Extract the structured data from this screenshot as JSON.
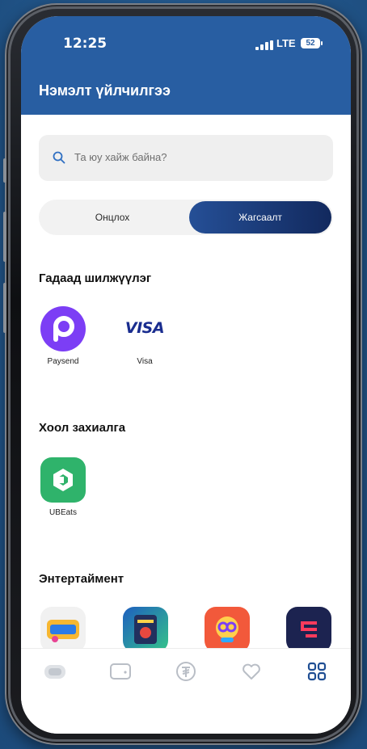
{
  "status_bar": {
    "time": "12:25",
    "network": "LTE",
    "battery": "52"
  },
  "header": {
    "title": "Нэмэлт үйлчилгээ"
  },
  "search": {
    "placeholder": "Та юу хайж байна?"
  },
  "segmented_control": {
    "options": [
      "Онцлох",
      "Жагсаалт"
    ],
    "selected": "Жагсаалт"
  },
  "sections": [
    {
      "title": "Гадаад шилжүүлэг",
      "apps": [
        {
          "label": "Paysend",
          "icon": "paysend-logo"
        },
        {
          "label": "Visa",
          "icon": "visa-logo",
          "logo_text": "VISA"
        }
      ]
    },
    {
      "title": "Хоол захиалга",
      "apps": [
        {
          "label": "UBEats",
          "icon": "ubeats-logo"
        }
      ]
    },
    {
      "title": "Энтертаймент",
      "apps": [
        {
          "label": "",
          "icon": "game-run-logo"
        },
        {
          "label": "",
          "icon": "gift-card-logo"
        },
        {
          "label": "",
          "icon": "gg-logo"
        },
        {
          "label": "",
          "icon": "dark-app-logo"
        }
      ]
    }
  ],
  "tab_bar": {
    "items": [
      {
        "icon": "card-icon"
      },
      {
        "icon": "wallet-icon"
      },
      {
        "icon": "currency-icon"
      },
      {
        "icon": "heart-icon"
      },
      {
        "icon": "grid-icon",
        "active": true
      }
    ]
  },
  "colors": {
    "header": "#285ea2",
    "accent": "#12295e",
    "active_tab": "#1f4e93",
    "inactive_tab": "#b9bec6"
  }
}
